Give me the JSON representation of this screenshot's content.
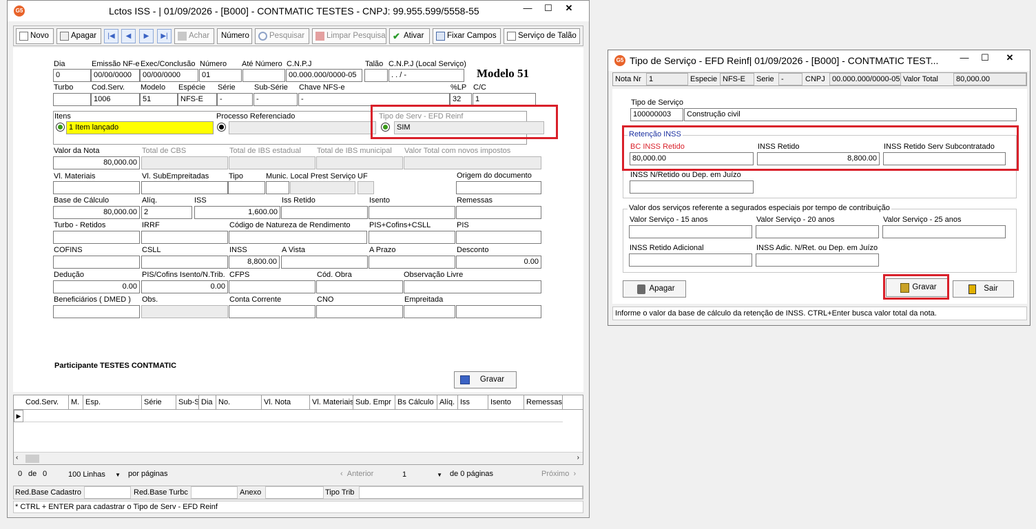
{
  "main": {
    "title": "Lctos ISS - |  01/09/2026 - [B000] - CONTMATIC  TESTES - CNPJ: 99.955.599/5558-55",
    "toolbar": {
      "novo": "Novo",
      "apagar": "Apagar",
      "achar": "Achar",
      "numero": "Número",
      "pesquisar": "Pesquisar",
      "limpar": "Limpar Pesquisa",
      "ativar": "Ativar",
      "fixar": "Fixar Campos",
      "servico_talao": "Serviço de Talão"
    },
    "modelo": "Modelo 51",
    "labels": {
      "dia": "Dia",
      "emissao": "Emissão NF-e",
      "exec": "Exec/Conclusão",
      "numero": "Número",
      "ate_numero": "Até Número",
      "cnpj": "C.N.P.J",
      "talao": "Talão",
      "cnpj_local": "C.N.P.J (Local Serviço)",
      "turbo": "Turbo",
      "cod_serv": "Cod.Serv.",
      "modelo": "Modelo",
      "especie": "Espécie",
      "serie": "Série",
      "sub_serie": "Sub-Série",
      "chave": "Chave NFS-e",
      "lp": "%LP",
      "cc": "C/C",
      "itens": "Itens",
      "processo": "Processo Referenciado",
      "tipo_serv": "Tipo de Serv - EFD Reinf",
      "valor_nota": "Valor da Nota",
      "total_cbs": "Total de CBS",
      "total_ibs_est": "Total de IBS estadual",
      "total_ibs_mun": "Total de IBS municipal",
      "valor_total_novos": "Valor Total com novos impostos",
      "vl_materiais": "Vl. Materiais",
      "vl_sub": "Vl. SubEmpreitadas",
      "tipo": "Tipo",
      "munic": "Munic. Local Prest Serviço",
      "uf": "UF",
      "origem": "Origem do documento",
      "base_calc": "Base de Cálculo",
      "aliq": "Alíq.",
      "iss": "ISS",
      "iss_retido": "Iss Retido",
      "isento": "Isento",
      "remessas": "Remessas",
      "turbo_ret": "Turbo - Retidos",
      "irrf": "IRRF",
      "cod_natureza": "Código de Natureza de Rendimento",
      "pis_cofins_csll": "PIS+Cofins+CSLL",
      "pis": "PIS",
      "cofins": "COFINS",
      "csll": "CSLL",
      "inss": "INSS",
      "a_vista": "A Vista",
      "a_prazo": "A Prazo",
      "desconto": "Desconto",
      "deducao": "Dedução",
      "pis_cofins_isento": "PIS/Cofins Isento/N.Trib.",
      "cfps": "CFPS",
      "cod_obra": "Cód. Obra",
      "obs_livre": "Observação Livre",
      "beneficiarios": "Beneficiários ( DMED )",
      "obs": "Obs.",
      "conta_corrente": "Conta Corrente",
      "cno": "CNO",
      "empreitada": "Empreitada"
    },
    "values": {
      "dia": "0",
      "emissao": "00/00/0000",
      "exec": "00/00/0000",
      "numero": "01",
      "cnpj": "00.000.000/0000-05",
      "cnpj_local": " .  .   /   -",
      "cod_serv": "1006",
      "modelo": "51",
      "especie": "NFS-E",
      "serie": "-",
      "sub_serie": "-",
      "chave": "-",
      "lp": "32",
      "cc": "1",
      "itens": "1 Item lançado",
      "tipo_serv": "SIM",
      "valor_nota": "80,000.00",
      "base_calc": "80,000.00",
      "aliq": "2",
      "iss": "1,600.00",
      "inss": "8,800.00",
      "desconto": "0.00",
      "deducao": "0.00",
      "pis_cofins_isento": "0.00"
    },
    "participante": "Participante TESTES CONTMATIC",
    "gravar": "Gravar",
    "grid_headers": [
      "Cod.Serv.",
      "M.",
      "Esp.",
      "Série",
      "Sub-S",
      "Dia",
      "No.",
      "Vl. Nota",
      "Vl. Materiais",
      "Sub. Empr",
      "Bs Cálculo",
      "Alíq.",
      "Iss",
      "Isento",
      "Remessas"
    ],
    "pager": {
      "count": "0",
      "de": "de",
      "total": "0",
      "linhas": "100 Linhas",
      "por_paginas": "por páginas",
      "anterior": "Anterior",
      "page": "1",
      "de_paginas": "de 0 páginas",
      "proximo": "Próximo"
    },
    "footer_labels": {
      "red_base_cadastro": "Red.Base Cadastro",
      "red_base_turbo": "Red.Base Turbc",
      "anexo": "Anexo",
      "tipo_trib": "Tipo Trib"
    },
    "status": "* CTRL + ENTER para  cadastrar o Tipo de Serv - EFD Reinf"
  },
  "dialog": {
    "title": "Tipo de Serviço - EFD Reinf|  01/09/2026 - [B000] - CONTMATIC  TEST...",
    "header": {
      "nota_nr_label": "Nota Nr",
      "nota_nr": "1",
      "especie_label": "Especie",
      "especie": "NFS-E",
      "serie_label": "Serie",
      "serie": "-",
      "cnpj_label": "CNPJ",
      "cnpj": "00.000.000/0000-05",
      "valor_total_label": "Valor Total",
      "valor_total": "80,000.00"
    },
    "tipo_servico_label": "Tipo de Serviço",
    "tipo_servico_code": "100000003",
    "tipo_servico_desc": "Construção civil",
    "retencao_title": "Retenção INSS",
    "bc_inss_label": "BC INSS Retido",
    "bc_inss": "80,000.00",
    "inss_retido_label": "INSS Retido",
    "inss_retido": "8,800.00",
    "inss_sub_label": "INSS Retido Serv Subcontratado",
    "inss_nret_label": "INSS N/Retido ou Dep. em Juízo",
    "valor_servicos_title": "Valor dos serviços referente a segurados especiais por tempo de contribuição",
    "vs15_label": "Valor Serviço - 15 anos",
    "vs20_label": "Valor Serviço - 20 anos",
    "vs25_label": "Valor Serviço - 25 anos",
    "inss_adicional_label": "INSS Retido Adicional",
    "inss_adic_nret_label": "INSS Adic. N/Ret. ou Dep. em Juízo",
    "apagar": "Apagar",
    "gravar": "Gravar",
    "sair": "Sair",
    "status": "Informe o valor da base de cálculo da retenção de INSS. CTRL+Enter busca valor total da nota."
  },
  "colors": {
    "highlight": "#d9202a",
    "yellow": "#ffff00",
    "accent": "#3b63c4"
  }
}
